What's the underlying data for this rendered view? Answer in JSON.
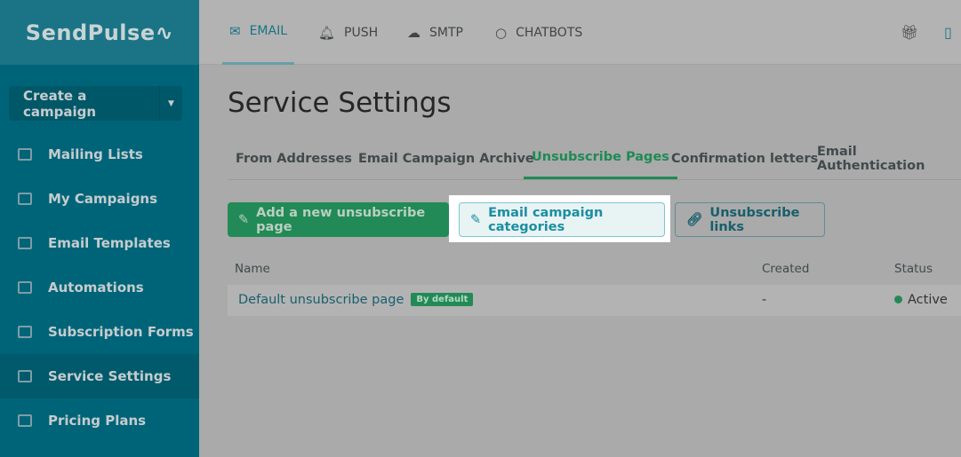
{
  "brand": "SendPulse",
  "sidebar": {
    "create_label": "Create a campaign",
    "items": [
      {
        "label": "Mailing Lists"
      },
      {
        "label": "My Campaigns"
      },
      {
        "label": "Email Templates"
      },
      {
        "label": "Automations"
      },
      {
        "label": "Subscription Forms"
      },
      {
        "label": "Service Settings",
        "active": true
      },
      {
        "label": "Pricing Plans"
      }
    ]
  },
  "topnav": [
    {
      "label": "EMAIL",
      "icon": "envelope-icon"
    },
    {
      "label": "PUSH",
      "icon": "bell-icon"
    },
    {
      "label": "SMTP",
      "icon": "cloud-upload-icon"
    },
    {
      "label": "CHATBOTS",
      "icon": "chat-icon"
    }
  ],
  "page_title": "Service Settings",
  "tabs": [
    "From Addresses",
    "Email Campaign Archive",
    "Unsubscribe Pages",
    "Confirmation letters",
    "Email Authentication"
  ],
  "actions": {
    "add": "Add a new unsubscribe page",
    "categories": "Email campaign categories",
    "links": "Unsubscribe links"
  },
  "table": {
    "headers": [
      "Name",
      "Created",
      "Status"
    ],
    "rows": [
      {
        "name": "Default unsubscribe page",
        "badge": "By default",
        "created": "-",
        "status": "Active"
      }
    ]
  }
}
